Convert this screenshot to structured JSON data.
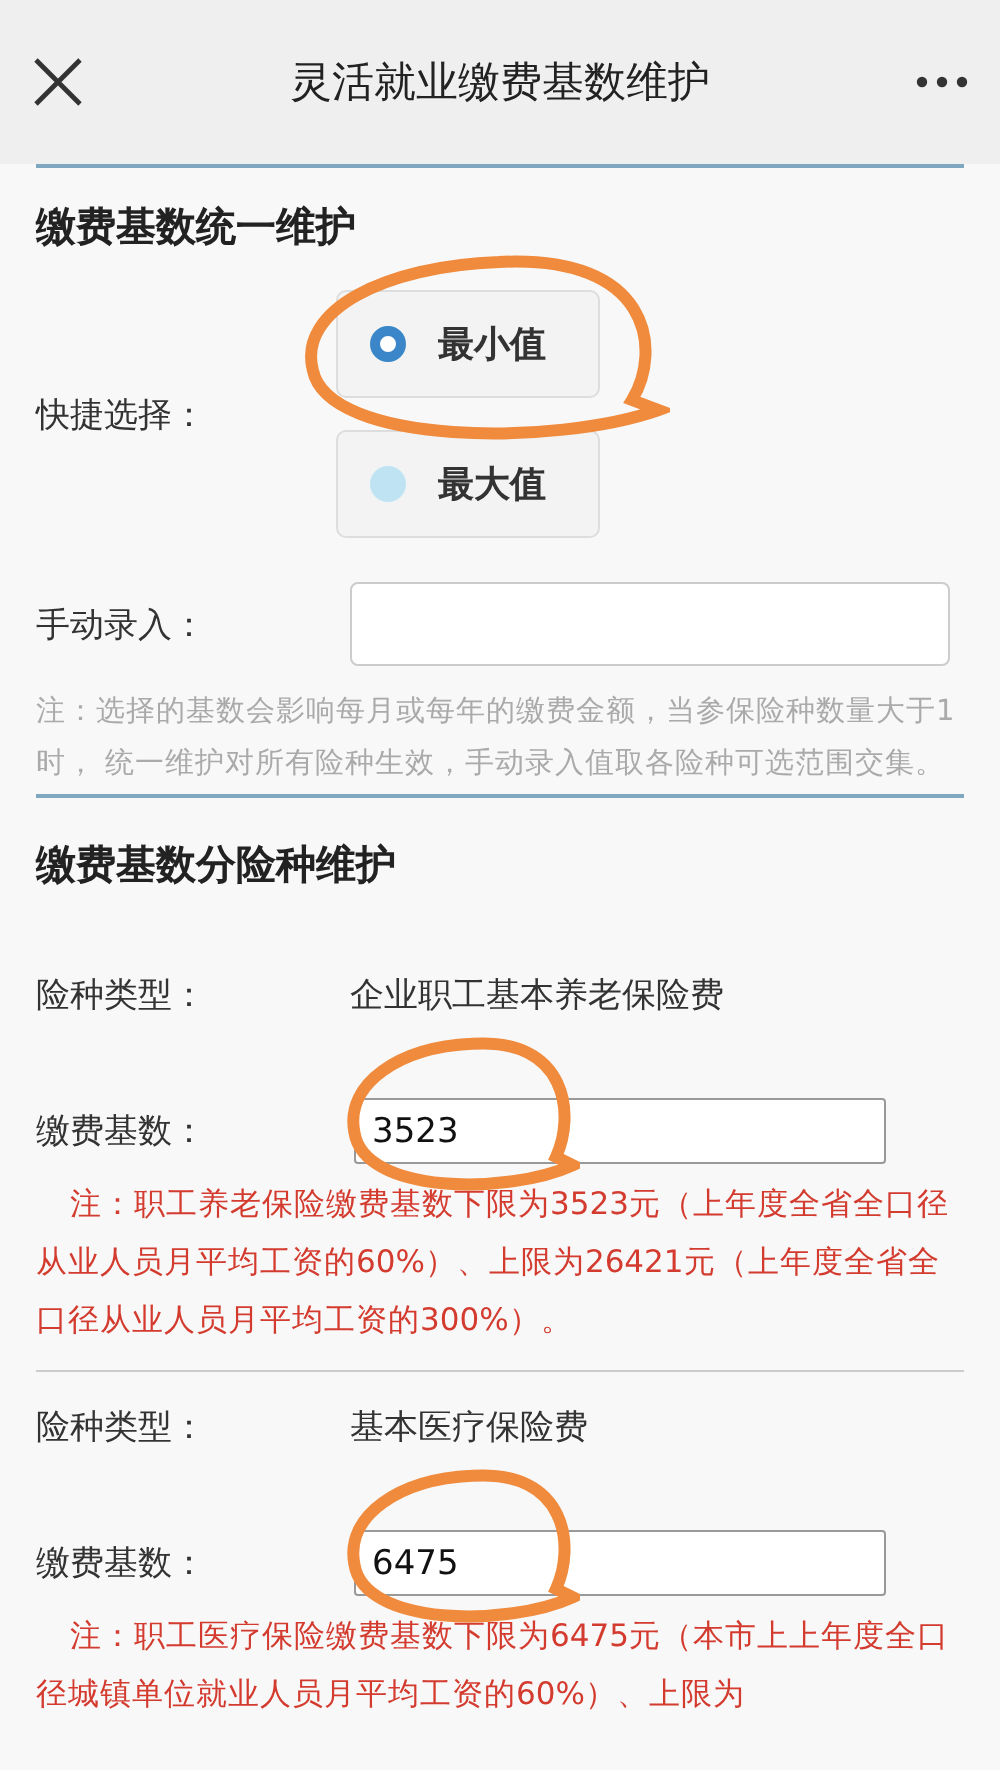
{
  "header": {
    "title": "灵活就业缴费基数维护"
  },
  "unified": {
    "title": "缴费基数统一维护",
    "quick_label": "快捷选择：",
    "options": [
      {
        "label": "最小值",
        "selected": true
      },
      {
        "label": "最大值",
        "selected": false
      }
    ],
    "manual_label": "手动录入：",
    "note": "注：选择的基数会影响每月或每年的缴费金额，当参保险种数量大于1时， 统一维护对所有险种生效，手动录入值取各险种可选范围交集。"
  },
  "per_type": {
    "title": "缴费基数分险种维护",
    "items": [
      {
        "type_label": "险种类型：",
        "type_value": "企业职工基本养老保险费",
        "base_label": "缴费基数：",
        "base_value": "3523",
        "note": "注：职工养老保险缴费基数下限为3523元（上年度全省全口径从业人员月平均工资的60%）、上限为26421元（上年度全省全口径从业人员月平均工资的300%）。"
      },
      {
        "type_label": "险种类型：",
        "type_value": "基本医疗保险费",
        "base_label": "缴费基数：",
        "base_value": "6475",
        "note": "注：职工医疗保险缴费基数下限为6475元（本市上上年度全口径城镇单位就业人员月平均工资的60%）、上限为"
      }
    ]
  }
}
